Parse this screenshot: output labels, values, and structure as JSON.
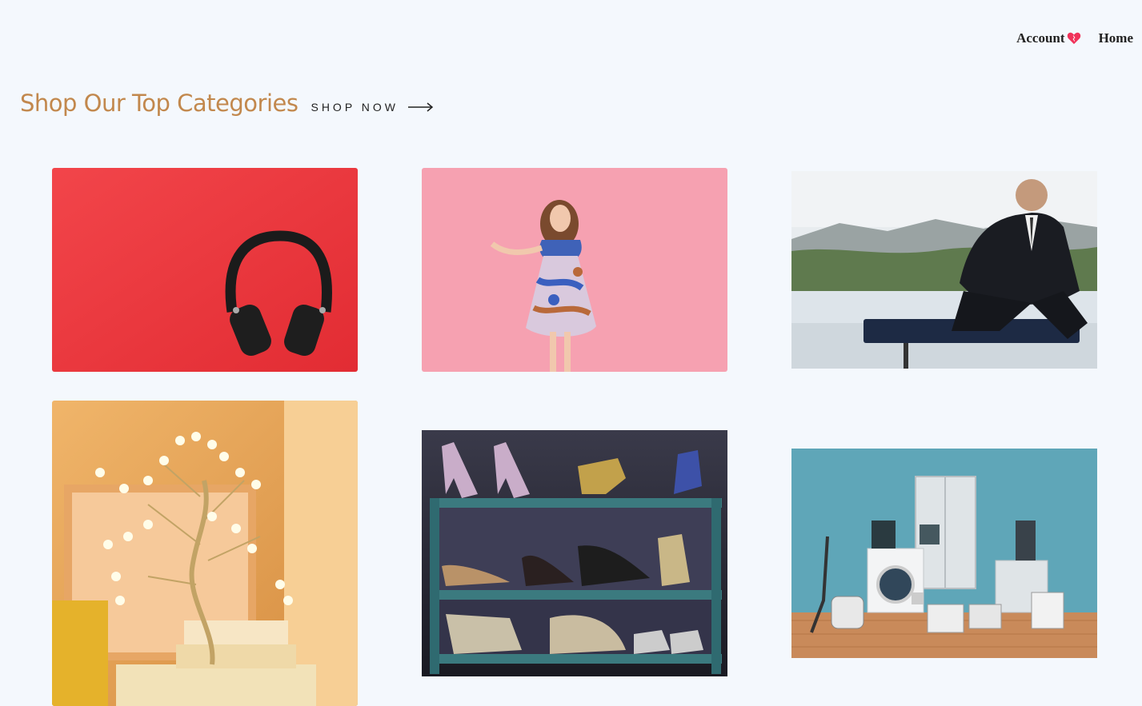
{
  "nav": {
    "account_label": "Account",
    "home_label": "Home"
  },
  "header": {
    "title": "Shop Our Top Categories",
    "cta_label": "SHOP NOW"
  },
  "colors": {
    "title": "#c2884d",
    "heart": "#f0325a",
    "background": "#f4f8fd"
  },
  "tiles": [
    {
      "subject": "headphones",
      "icon": "headphones-icon"
    },
    {
      "subject": "women-dress",
      "icon": "dress-icon"
    },
    {
      "subject": "men-suit",
      "icon": "suit-icon"
    },
    {
      "subject": "tree-lamp-decor",
      "icon": "lamp-icon"
    },
    {
      "subject": "shoes-shelf",
      "icon": "shoe-icon"
    },
    {
      "subject": "home-appliances",
      "icon": "appliance-icon"
    }
  ]
}
